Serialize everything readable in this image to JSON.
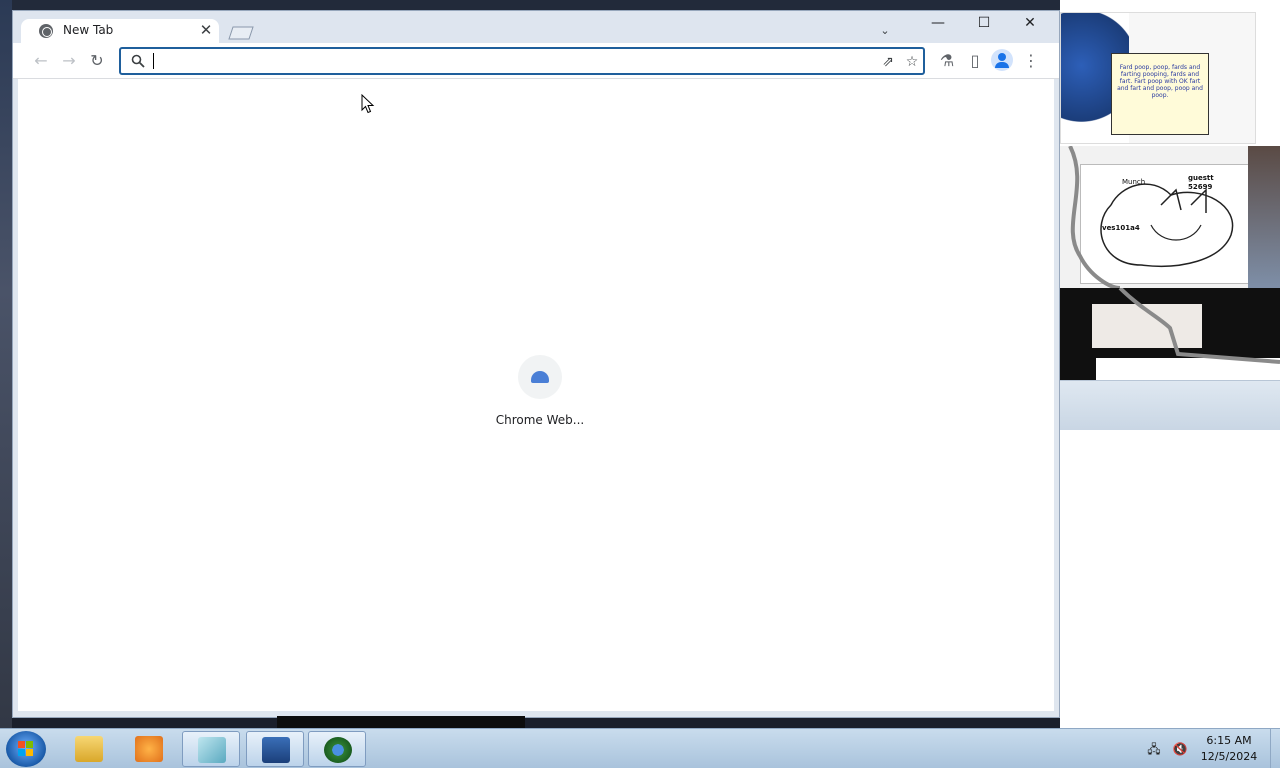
{
  "browser": {
    "tab": {
      "title": "New Tab",
      "close_glyph": "✕"
    },
    "window_controls": {
      "minimize": "—",
      "maximize": "☐",
      "close": "✕"
    },
    "tab_search_glyph": "⌄",
    "toolbar": {
      "back_glyph": "←",
      "forward_glyph": "→",
      "reload_glyph": "↻",
      "omnibox_value": "",
      "share_glyph": "⇗",
      "bookmark_glyph": "☆",
      "labs_glyph": "⚗",
      "side_panel_glyph": "▯",
      "menu_glyph": "⋮"
    },
    "shortcut": {
      "label": "Chrome Web..."
    }
  },
  "right_panel": {
    "note_text": "Fard poop, poop, fards and farting pooping, fards and fart. Fart poop with OK fart and fart and poop, poop and poop.",
    "sketch_label_1": "guestt",
    "sketch_label_2": "52699",
    "sketch_label_3": "ves101a4",
    "sketch_label_4": "Munch"
  },
  "taskbar": {
    "clock_time": "6:15 AM",
    "clock_date": "12/5/2024",
    "network_glyph": "🖧",
    "volume_glyph": "🔇"
  },
  "colors": {
    "omnibox_focus": "#1f5f9c",
    "tabstrip": "#dee5ef",
    "taskbar": "#b9d0e6"
  }
}
